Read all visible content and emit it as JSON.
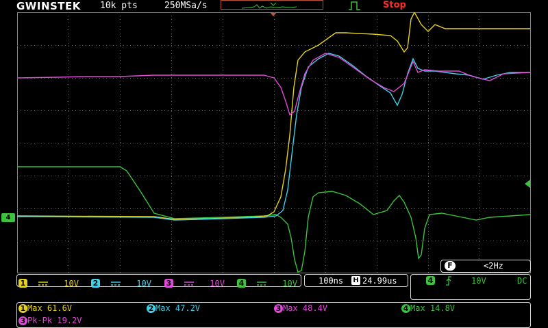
{
  "header": {
    "brand": "GWINSTEK",
    "record_length": "10k pts",
    "sample_rate": "250MSa/s",
    "run_status": "Stop"
  },
  "colors": {
    "ch1": "#e6d21e",
    "ch2": "#3fd0e8",
    "ch3": "#e04ad8",
    "ch4": "#3cc23c",
    "status": "#ff2a2a",
    "grid": "#7a7a7a"
  },
  "channels": [
    {
      "num": "1",
      "scale": "10V",
      "color": "#e6d21e"
    },
    {
      "num": "2",
      "scale": "10V",
      "color": "#3fd0e8"
    },
    {
      "num": "3",
      "scale": "10V",
      "color": "#e04ad8"
    },
    {
      "num": "4",
      "scale": "10V",
      "color": "#3cc23c"
    }
  ],
  "timebase": {
    "scale": "100ns",
    "delay_icon": "H",
    "delay": "24.99us"
  },
  "trigger": {
    "source": "4",
    "slope_icon": "rising-edge",
    "level": "10V",
    "coupling": "DC"
  },
  "frequency": {
    "badge": "F",
    "value": "<2Hz"
  },
  "ground_marker": "4",
  "measurements": [
    {
      "ch": "1",
      "label": "Max 61.6V",
      "color": "#e6d21e"
    },
    {
      "ch": "2",
      "label": "Max 47.2V",
      "color": "#3fd0e8"
    },
    {
      "ch": "3",
      "label": "Max 48.4V",
      "color": "#e04ad8"
    },
    {
      "ch": "4",
      "label": "Max 14.8V",
      "color": "#3cc23c"
    },
    {
      "ch": "3",
      "label": "Pk-Pk 19.2V",
      "color": "#e04ad8"
    }
  ]
}
